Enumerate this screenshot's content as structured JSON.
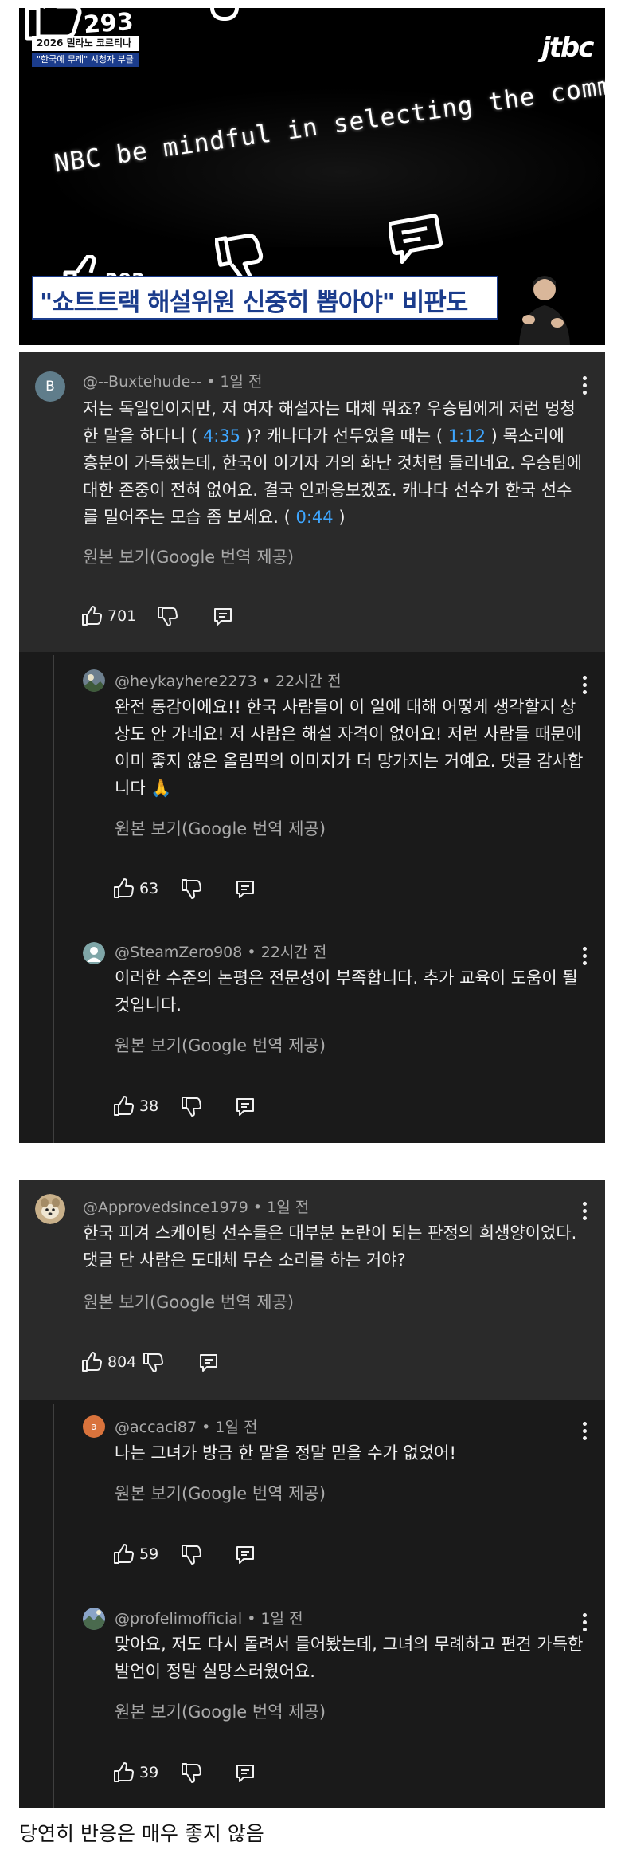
{
  "video": {
    "broadcast_title": "2026 밀라노 코르티나",
    "broadcast_subtitle": "\"한국에 무례\" 시청자 부글",
    "channel_logo": "jtbc",
    "overlay_number_top": "293",
    "overlay_number_bottom": "292",
    "caption": "NBC be mindful in selecting the comment",
    "headline": "\"쇼트트랙 해설위원 신중히 뽑아야\" 비판도",
    "colors": {
      "headline_blue": "#1b3c8c",
      "background": "#000000"
    }
  },
  "panel_1": {
    "top_comment": {
      "avatar_letter": "B",
      "avatar_color": "#607d8b",
      "handle": "@--Buxtehude--",
      "time": "1일 전",
      "text_parts": [
        "저는 독일인이지만, 저 여자 해설자는 대체 뭐죠? 우승팀에게 저런 멍청한 말을 하다니 (",
        "4:35",
        ")? 캐나다가 선두였을 때는 (",
        "1:12",
        ") 목소리에 흥분이 가득했는데, 한국이 이기자 거의 화난 것처럼 들리네요. 우승팀에 대한 존중이 전혀 없어요. 결국 인과응보겠죠. 캐나다 선수가 한국 선수를 밀어주는 모습 좀 보세요. (",
        "0:44",
        ")"
      ],
      "translate_label": "원본 보기(Google 번역 제공)",
      "likes": "701"
    },
    "replies": [
      {
        "handle": "@heykayhere2273",
        "time": "22시간 전",
        "avatar_icon": "landscape-avatar-icon",
        "text": "완전 동감이에요!! 한국 사람들이 이 일에 대해 어떻게 생각할지 상상도 안 가네요! 저 사람은 해설 자격이 없어요! 저런 사람들 때문에 이미 좋지 않은 올림픽의 이미지가 더 망가지는 거예요. 댓글 감사합니다 🙏",
        "translate_label": "원본 보기(Google 번역 제공)",
        "likes": "63"
      },
      {
        "handle": "@SteamZero908",
        "time": "22시간 전",
        "avatar_icon": "person-avatar-icon",
        "text": "이러한 수준의 논평은 전문성이 부족합니다. 추가 교육이 도움이 될 것입니다.",
        "translate_label": "원본 보기(Google 번역 제공)",
        "likes": "38"
      }
    ]
  },
  "panel_2": {
    "top_comment": {
      "avatar_icon": "animal-avatar-icon",
      "handle": "@Approvedsince1979",
      "time": "1일 전",
      "text": "한국 피겨 스케이팅 선수들은 대부분 논란이 되는 판정의 희생양이었다. 댓글 단 사람은 도대체 무슨 소리를 하는 거야?",
      "translate_label": "원본 보기(Google 번역 제공)",
      "likes": "804"
    },
    "replies": [
      {
        "handle": "@accaci87",
        "time": "1일 전",
        "avatar_letter": "a",
        "avatar_color": "#d9733c",
        "text": "나는 그녀가 방금 한 말을 정말 믿을 수가 없었어!",
        "translate_label": "원본 보기(Google 번역 제공)",
        "likes": "59"
      },
      {
        "handle": "@profelimofficial",
        "time": "1일 전",
        "avatar_icon": "landscape-avatar-icon",
        "text": "맞아요, 저도 다시 돌려서 들어봤는데, 그녀의 무례하고 편견 가득한 발언이 정말 실망스러웠어요.",
        "translate_label": "원본 보기(Google 번역 제공)",
        "likes": "39"
      }
    ]
  },
  "footer": {
    "caption": "당연히 반응은 매우 좋지 않음"
  },
  "theme": {
    "panel_bg": "#1a1a1a",
    "top_comment_bg": "#2a2a2a",
    "timestamp_link": "#3ea6ff",
    "muted_text": "#aaaaaa"
  }
}
